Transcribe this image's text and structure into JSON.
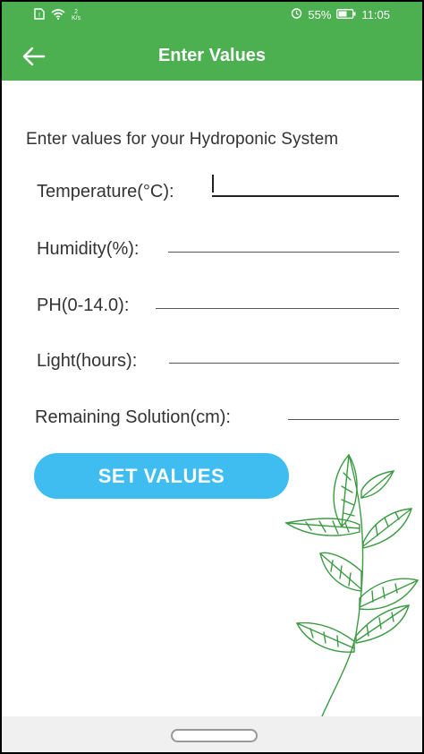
{
  "status_bar": {
    "network_speed_top": "2",
    "network_speed_unit": "K/s",
    "battery": "55%",
    "time": "11:05"
  },
  "app_bar": {
    "title": "Enter Values"
  },
  "form": {
    "intro": "Enter values for your Hydroponic System",
    "fields": [
      {
        "label": "Temperature(°C):",
        "value": ""
      },
      {
        "label": "Humidity(%):",
        "value": ""
      },
      {
        "label": "PH(0-14.0):",
        "value": ""
      },
      {
        "label": "Light(hours):",
        "value": ""
      },
      {
        "label": "Remaining Solution(cm):",
        "value": ""
      }
    ],
    "submit_label": "SET VALUES"
  },
  "colors": {
    "app_bar": "#4CAF50",
    "button": "#3FBDF0",
    "leaf": "#3c9a43"
  },
  "icons": [
    "back-arrow-icon",
    "sim-icon",
    "wifi-icon",
    "alarm-icon",
    "battery-icon",
    "leaf-branch-illustration"
  ]
}
